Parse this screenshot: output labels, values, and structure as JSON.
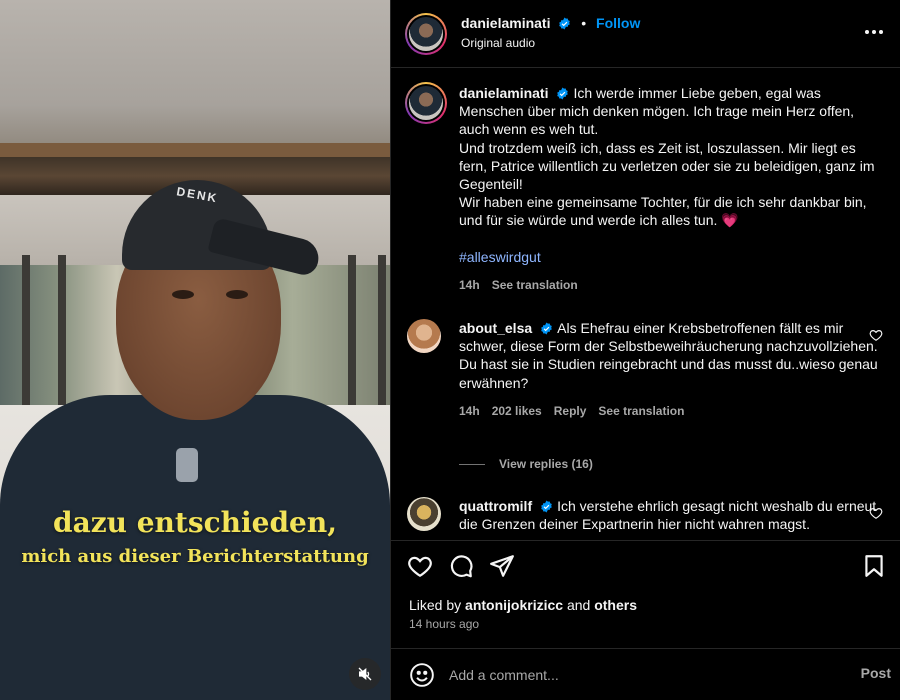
{
  "video": {
    "caption_line1": "dazu entschieden,",
    "caption_line2": "mich aus dieser Berichterstattung",
    "cap_text": "DENK",
    "mute_icon": "speaker-muted-icon"
  },
  "header": {
    "username": "danielaminati",
    "dot": "•",
    "follow_label": "Follow",
    "audio_label": "Original audio",
    "more_icon": "more-horizontal-icon"
  },
  "post": {
    "username": "danielaminati",
    "text": "Ich werde immer Liebe geben, egal was Menschen über mich denken mögen. Ich trage mein Herz offen, auch wenn es weh tut.\nUnd trotzdem weiß ich, dass es Zeit ist, loszulassen. Mir liegt es fern, Patrice willentlich zu verletzen oder sie zu beleidigen, ganz im Gegenteil!\nWir haben eine gemeinsame Tochter, für die ich sehr dankbar bin, und für sie würde und werde ich alles tun. 💗",
    "hashtag": "#alleswirdgut",
    "time": "14h",
    "see_translation": "See translation"
  },
  "comments": [
    {
      "username": "about_elsa",
      "text": "Als Ehefrau einer Krebsbetroffenen fällt es mir schwer, diese Form der Selbstbeweihräucherung nachzuvollziehen.\nDu hast sie in Studien reingebracht und das musst du..wieso genau erwähnen?",
      "time": "14h",
      "likes": "202 likes",
      "reply": "Reply",
      "see_translation": "See translation",
      "view_replies": "View replies (16)"
    },
    {
      "username": "quattromilf",
      "text": "Ich verstehe ehrlich gesagt nicht weshalb du erneut die Grenzen deiner Expartnerin hier nicht wahren magst."
    }
  ],
  "footer": {
    "liked_by_prefix": "Liked by",
    "liked_by_user": "antonijokrizicc",
    "and": "and",
    "others": "others",
    "timestamp": "14 hours ago",
    "add_comment_placeholder": "Add a comment...",
    "post_label": "Post"
  },
  "colors": {
    "background": "#000000",
    "text": "#f5f5f5",
    "secondary": "#a8a8a8",
    "follow_blue": "#0095f6",
    "verified_blue": "#0095f6",
    "caption_yellow": "#f2e35a"
  }
}
